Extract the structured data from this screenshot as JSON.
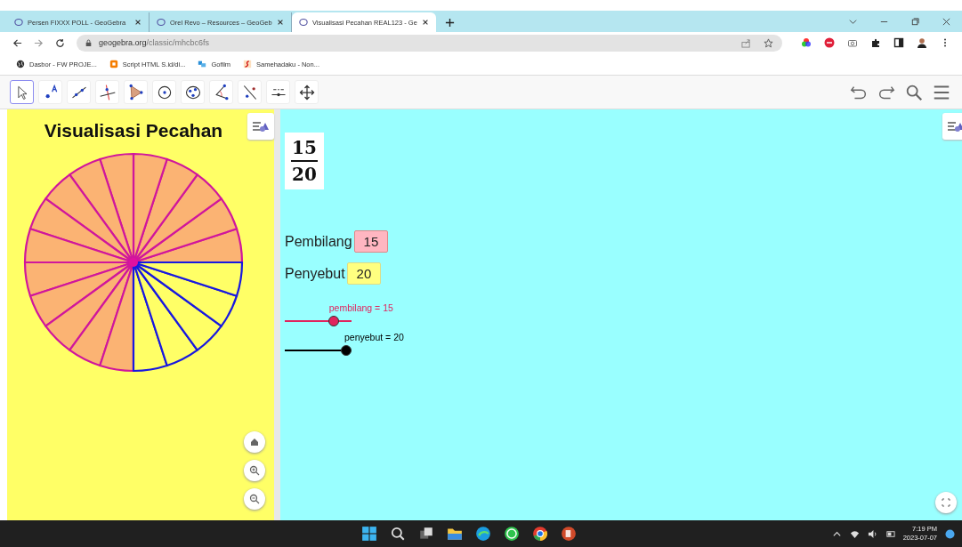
{
  "browser": {
    "tabs": [
      {
        "title": "Persen FIXXX POLL - GeoGebra",
        "selected": false
      },
      {
        "title": "Orel Revo – Resources – GeoGeb",
        "selected": false
      },
      {
        "title": "Visualisasi Pecahan REAL123 - Ge",
        "selected": true
      }
    ],
    "url_domain": "geogebra.org",
    "url_path": "/classic/mhcbc6fs",
    "bookmarks": [
      "Dasbor - FW PROJE...",
      "Script HTML S.id/di...",
      "Gofilm",
      "Samehadaku - Non..."
    ]
  },
  "toolbar": {
    "tools": [
      {
        "selected": true
      },
      {
        "selected": false
      },
      {
        "selected": false
      },
      {
        "selected": false
      },
      {
        "selected": false
      },
      {
        "selected": false
      },
      {
        "selected": false
      },
      {
        "selected": false
      },
      {
        "selected": false
      },
      {
        "selected": false
      },
      {
        "selected": false
      }
    ]
  },
  "graphics": {
    "title": "Visualisasi Pecahan"
  },
  "algebra": {
    "fraction": {
      "numerator": "15",
      "denominator": "20"
    },
    "inputs": [
      {
        "label": "Pembilang",
        "value": "15",
        "color": "#ffb6c1"
      },
      {
        "label": "Penyebut",
        "value": "20",
        "color": "#ffff80"
      }
    ],
    "sliders": [
      {
        "label": "pembilang = 15",
        "level": 0.77,
        "color": "#e0245e"
      },
      {
        "label": "penyebut = 20",
        "level": 1.0,
        "color": "#000000"
      }
    ]
  },
  "taskbar": {
    "time": "7:19 PM",
    "date": "2023-07-07"
  }
}
